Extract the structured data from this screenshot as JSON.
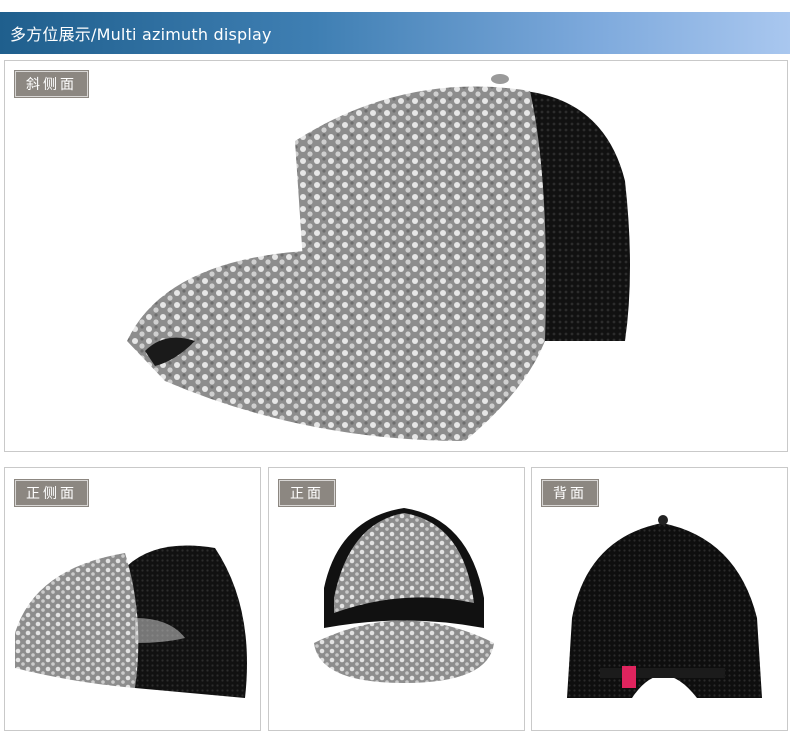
{
  "header": {
    "title": "多方位展示/Multi azimuth display",
    "bg_start": "#1f5f8d",
    "bg_end": "#a9c7ef"
  },
  "panels": {
    "oblique": {
      "label": "斜侧面"
    },
    "side": {
      "label": "正侧面"
    },
    "front": {
      "label": "正面"
    },
    "back": {
      "label": "背面"
    }
  },
  "colors": {
    "label_bg": "#8c8781",
    "sequin": "#b9b9b9",
    "mesh": "#151515",
    "tag": "#e0245e"
  }
}
